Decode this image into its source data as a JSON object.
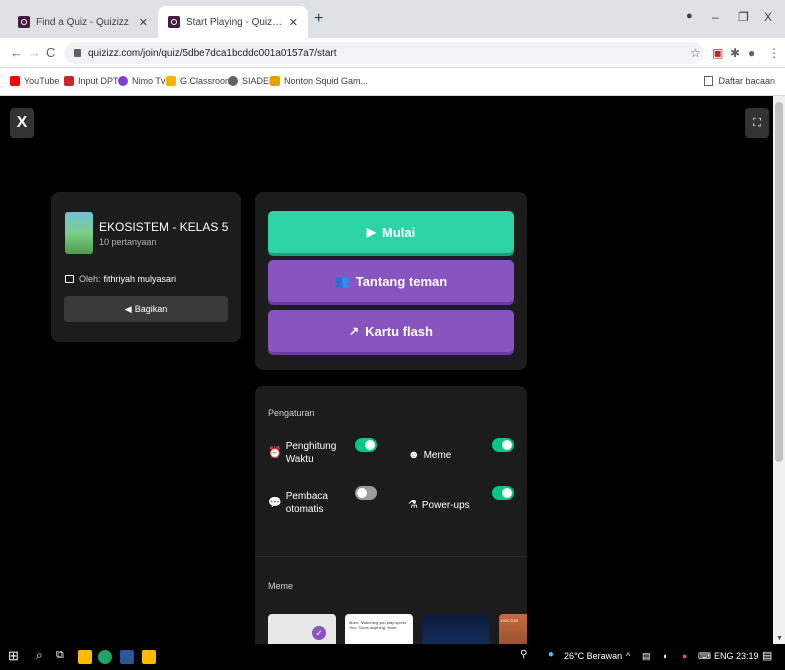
{
  "browser": {
    "tabs": [
      {
        "title": "Find a Quiz - Quizizz",
        "active": false
      },
      {
        "title": "Start Playing - Quizizz",
        "active": true
      }
    ],
    "new_tab": "+",
    "window_controls": {
      "minimize": "–",
      "restore": "❐",
      "close": "X"
    },
    "nav": {
      "back": "←",
      "forward": "→",
      "reload": "C"
    },
    "url": "quizizz.com/join/quiz/5dbe7dca1bcddc001a0157a7/start",
    "bookmarks": [
      {
        "label": "YouTube",
        "color": "#ff0000"
      },
      {
        "label": "Input DPT",
        "color": "#c62828"
      },
      {
        "label": "Nimo Tv",
        "color": "#7b3fd6"
      },
      {
        "label": "G.Classroom",
        "color": "#f4b400"
      },
      {
        "label": "SIADEK",
        "color": "#5f6368"
      },
      {
        "label": "Nonton Squid Gam...",
        "color": "#e6a100"
      }
    ],
    "reading_list": "Daftar bacaan"
  },
  "page": {
    "close_label": "X",
    "fullscreen_label": "⛶",
    "quiz": {
      "title": "EKOSISTEM - KELAS 5",
      "count": "10 pertanyaan",
      "author_label": "Oleh:",
      "author_name": "fithriyah mulyasari",
      "share_label": "Bagikan"
    },
    "actions": {
      "start": "Mulai",
      "challenge": "Tantang teman",
      "flashcards": "Kartu flash"
    },
    "settings": {
      "title": "Pengaturan",
      "options": [
        {
          "label_line1": "Penghitung",
          "label_line2": "Waktu",
          "on": true,
          "icon": "timer-icon"
        },
        {
          "label_line1": "Meme",
          "label_line2": "",
          "on": true,
          "icon": "meme-icon"
        },
        {
          "label_line1": "Pembaca",
          "label_line2": "otomatis",
          "on": false,
          "icon": "reader-icon"
        },
        {
          "label_line1": "Power-ups",
          "label_line2": "",
          "on": true,
          "icon": "powerup-icon"
        }
      ],
      "meme_title": "Meme",
      "meme_samples": [
        {
          "text": ""
        },
        {
          "text": "Mom: \"Watching you play sports\" You: \"Does anything\" Mom:"
        },
        {
          "text": ""
        },
        {
          "text": "DOCTOR"
        }
      ]
    }
  },
  "taskbar": {
    "weather": "26°C Berawan",
    "language": "ENG",
    "time": "23:19"
  },
  "colors": {
    "start": "#2cd3a4",
    "purple": "#8854c0",
    "toggle_on": "#00c985",
    "page_bg": "#000000",
    "card_bg": "#1c1c1c"
  }
}
